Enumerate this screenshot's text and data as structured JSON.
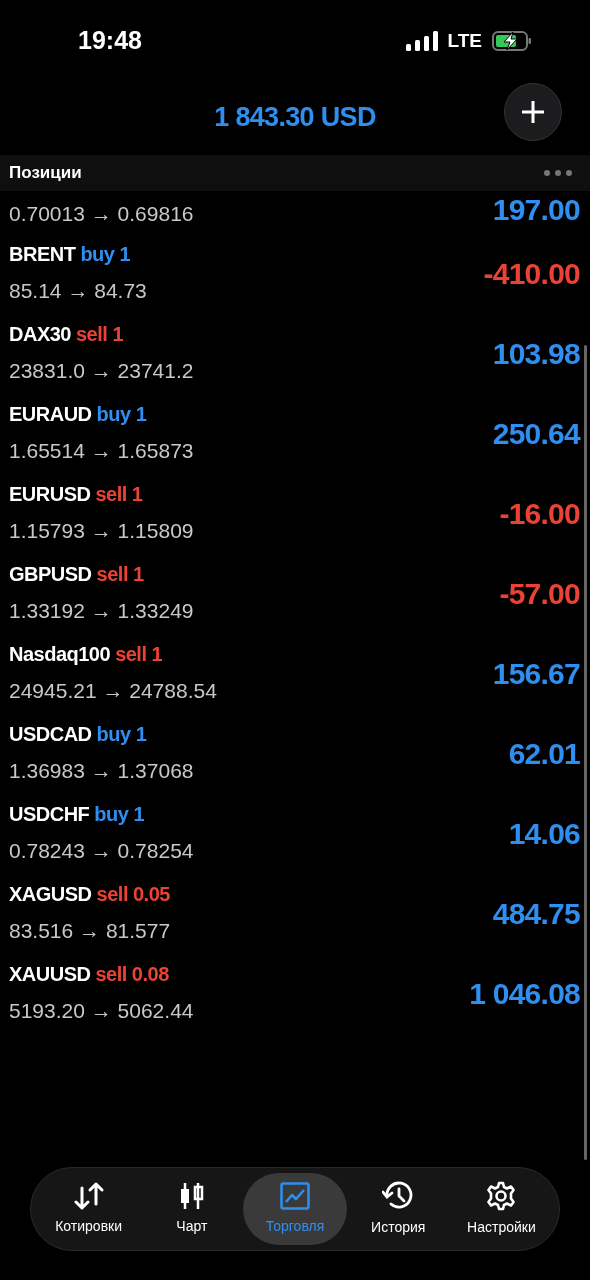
{
  "status_bar": {
    "time": "19:48",
    "network": "LTE"
  },
  "balance": "1 843.30 USD",
  "section": {
    "title": "Позиции"
  },
  "positions": [
    {
      "prices": "0.70013 → 0.69816",
      "profit": "197.00",
      "kind": "profit"
    },
    {
      "symbol": "BRENT",
      "side": "buy",
      "volume": "1",
      "prices": "85.14 → 84.73",
      "profit": "-410.00",
      "kind": "loss"
    },
    {
      "symbol": "DAX30",
      "side": "sell",
      "volume": "1",
      "prices": "23831.0 → 23741.2",
      "profit": "103.98",
      "kind": "profit"
    },
    {
      "symbol": "EURAUD",
      "side": "buy",
      "volume": "1",
      "prices": "1.65514 → 1.65873",
      "profit": "250.64",
      "kind": "profit"
    },
    {
      "symbol": "EURUSD",
      "side": "sell",
      "volume": "1",
      "prices": "1.15793 → 1.15809",
      "profit": "-16.00",
      "kind": "loss"
    },
    {
      "symbol": "GBPUSD",
      "side": "sell",
      "volume": "1",
      "prices": "1.33192 → 1.33249",
      "profit": "-57.00",
      "kind": "loss"
    },
    {
      "symbol": "Nasdaq100",
      "side": "sell",
      "volume": "1",
      "prices": "24945.21 → 24788.54",
      "profit": "156.67",
      "kind": "profit"
    },
    {
      "symbol": "USDCAD",
      "side": "buy",
      "volume": "1",
      "prices": "1.36983 → 1.37068",
      "profit": "62.01",
      "kind": "profit"
    },
    {
      "symbol": "USDCHF",
      "side": "buy",
      "volume": "1",
      "prices": "0.78243 → 0.78254",
      "profit": "14.06",
      "kind": "profit"
    },
    {
      "symbol": "XAGUSD",
      "side": "sell",
      "volume": "0.05",
      "prices": "83.516 → 81.577",
      "profit": "484.75",
      "kind": "profit"
    },
    {
      "symbol": "XAUUSD",
      "side": "sell",
      "volume": "0.08",
      "prices": "5193.20 → 5062.44",
      "profit": "1 046.08",
      "kind": "profit"
    }
  ],
  "tab_bar": [
    {
      "label": "Котировки",
      "kind": "quotes",
      "selected": false
    },
    {
      "label": "Чарт",
      "kind": "chart",
      "selected": false
    },
    {
      "label": "Торговля",
      "kind": "trade",
      "selected": true
    },
    {
      "label": "История",
      "kind": "history",
      "selected": false
    },
    {
      "label": "Настройки",
      "kind": "settings",
      "selected": false
    }
  ]
}
